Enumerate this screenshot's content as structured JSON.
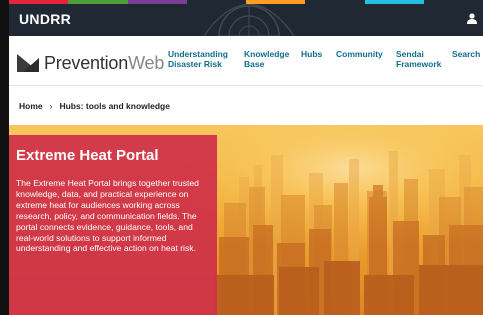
{
  "topbar": {
    "org_label": "UNDRR",
    "strip_colors": [
      "#e5243b",
      "#4c9f38",
      "#7a3f95",
      "#1f2833",
      "#fd9d24",
      "#1f2833",
      "#26bde2",
      "#1f2833"
    ],
    "user_icon": "user-icon"
  },
  "header": {
    "logo_bold": "Prevention",
    "logo_light": "Web",
    "nav": [
      {
        "line1": "Understanding",
        "line2": "Disaster Risk"
      },
      {
        "line1": "Knowledge",
        "line2": "Base"
      },
      {
        "line1": "Hubs",
        "line2": ""
      },
      {
        "line1": "Community",
        "line2": ""
      },
      {
        "line1": "Sendai",
        "line2": "Framework"
      },
      {
        "line1": "Search",
        "line2": ""
      }
    ]
  },
  "breadcrumb": {
    "home": "Home",
    "separator": "›",
    "current": "Hubs: tools and knowledge"
  },
  "hero": {
    "image": "city-skyline-heat-haze",
    "title": "Extreme Heat Portal",
    "body": "The Extreme Heat Portal brings together trusted knowledge, data, and practical experience on extreme heat for audiences working across research, policy, and communication fields. The portal connects evidence, guidance, tools, and real-world solutions to support informed understanding and effective action on heat risk."
  },
  "colors": {
    "nav_link": "#0f6e8c",
    "panel": "#cf3048",
    "topbar": "#1f2833"
  }
}
